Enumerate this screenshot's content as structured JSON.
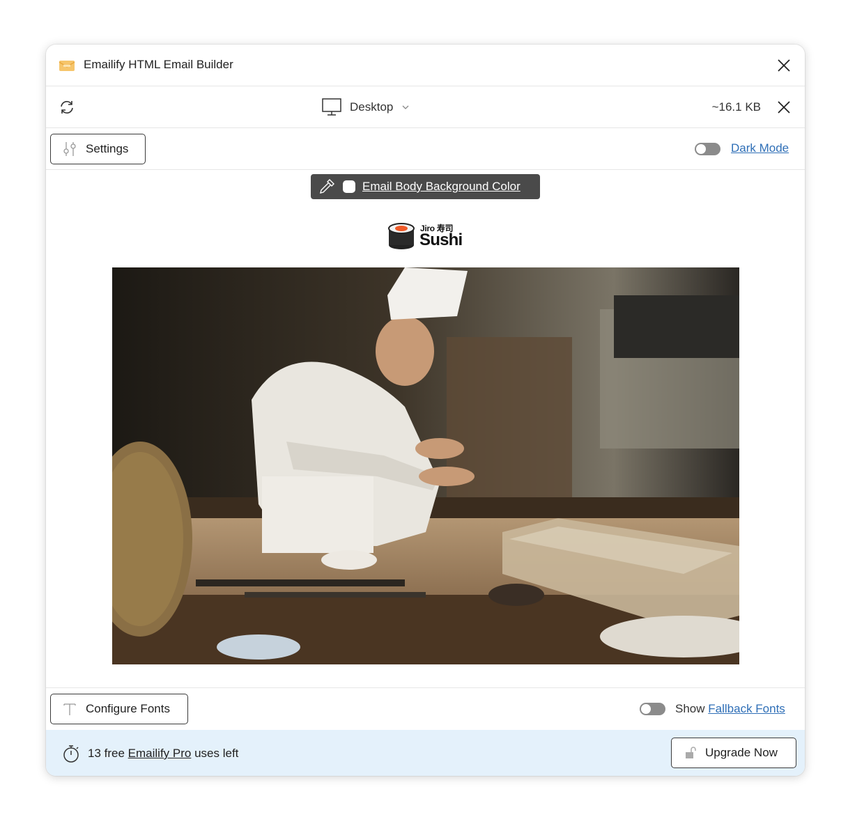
{
  "titlebar": {
    "title": "Emailify HTML Email Builder"
  },
  "toolbar": {
    "device": "Desktop",
    "file_size": "~16.1 KB"
  },
  "settings": {
    "settings_label": "Settings",
    "dark_mode_label": "Dark Mode",
    "dark_mode_on": false
  },
  "canvas": {
    "bg_color_label": "Email Body Background Color",
    "bg_color": "#ffffff",
    "logo_small": "Jiro 寿司",
    "logo_big": "Sushi"
  },
  "fonts": {
    "configure_label": "Configure Fonts",
    "show_label": "Show",
    "fallback_label": "Fallback Fonts",
    "fallback_on": false
  },
  "footer": {
    "uses_count": "13 free",
    "pro_label": "Emailify Pro",
    "uses_suffix": "uses left",
    "upgrade_label": "Upgrade Now"
  },
  "colors": {
    "accent_link": "#2f6fb7",
    "footer_bg": "#e4f1fb",
    "pill_bg": "#4a4a4a"
  }
}
